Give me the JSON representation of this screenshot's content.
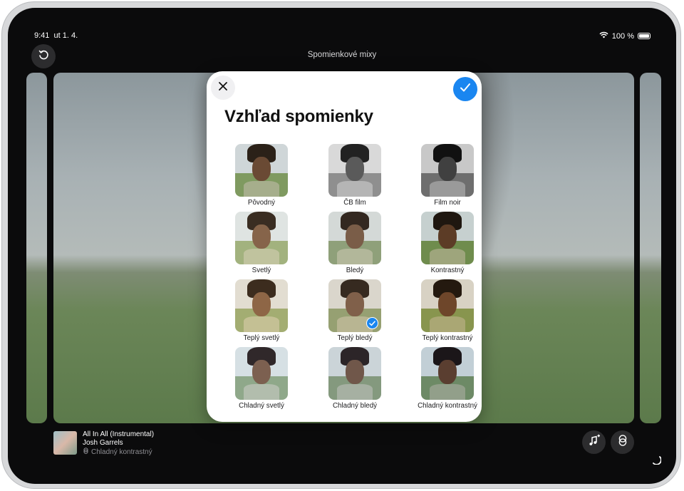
{
  "status_bar": {
    "time": "9:41",
    "date": "ut 1. 4.",
    "battery_text": "100 %"
  },
  "nav": {
    "title": "Spomienkové mixy"
  },
  "modal": {
    "title": "Vzhľad spomienky",
    "options": [
      {
        "label": "Pôvodný",
        "style": "original",
        "selected": false
      },
      {
        "label": "ČB film",
        "style": "bw",
        "selected": false
      },
      {
        "label": "Film noir",
        "style": "noir",
        "selected": false
      },
      {
        "label": "Svetlý",
        "style": "light",
        "selected": false
      },
      {
        "label": "Bledý",
        "style": "pale",
        "selected": false
      },
      {
        "label": "Kontrastný",
        "style": "contrast",
        "selected": false
      },
      {
        "label": "Teplý svetlý",
        "style": "warm-light",
        "selected": false
      },
      {
        "label": "Teplý bledý",
        "style": "warm-pale",
        "selected": true
      },
      {
        "label": "Teplý kontrastný",
        "style": "warm-contrast",
        "selected": false
      },
      {
        "label": "Chladný svetlý",
        "style": "cool-light",
        "selected": false
      },
      {
        "label": "Chladný bledý",
        "style": "cool-pale",
        "selected": false
      },
      {
        "label": "Chladný kontrastný",
        "style": "cool-contrast",
        "selected": false
      }
    ]
  },
  "now_playing": {
    "title": "All In All (Instrumental)",
    "artist": "Josh Garrels",
    "look": "Chladný kontrastný"
  },
  "colors": {
    "accent": "#1a86f0",
    "screen_bg": "#0b0b0c",
    "modal_bg": "#ffffff"
  },
  "icons": [
    "undo-icon",
    "wifi-icon",
    "battery-icon",
    "close-icon",
    "checkmark-icon",
    "music-plus-icon",
    "look-filter-icon",
    "spinner-icon"
  ]
}
